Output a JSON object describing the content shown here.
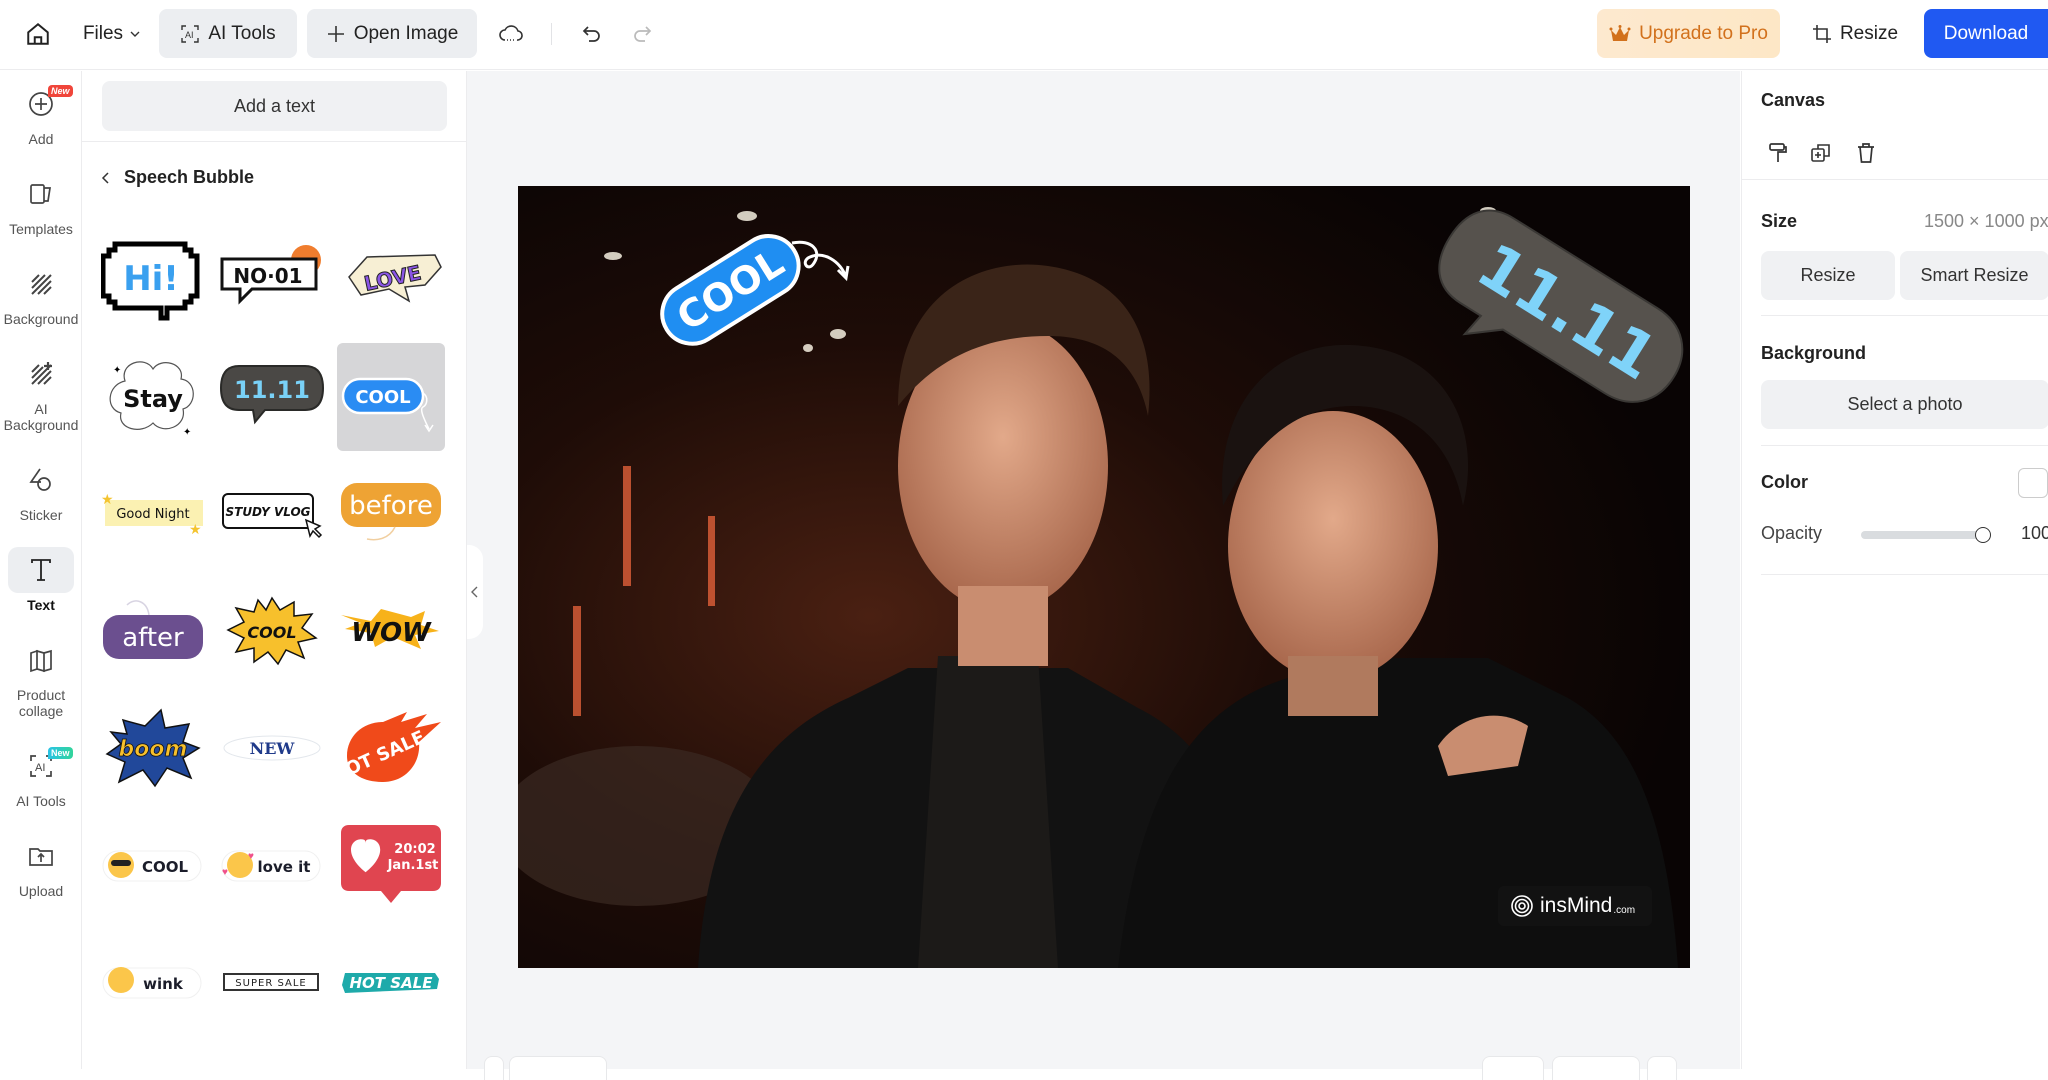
{
  "topbar": {
    "files_label": "Files",
    "ai_tools_label": "AI Tools",
    "open_image_label": "Open Image",
    "upgrade_label": "Upgrade to Pro",
    "resize_label": "Resize",
    "download_label": "Download",
    "colors": {
      "download_bg": "#2059f2",
      "upgrade_text": "#d2711c",
      "upgrade_bg": "#fde9cf"
    }
  },
  "rail": {
    "items": [
      {
        "label": "Add",
        "icon": "plus-circle-icon",
        "badge": "New"
      },
      {
        "label": "Templates",
        "icon": "templates-icon"
      },
      {
        "label": "Background",
        "icon": "background-hatch-icon"
      },
      {
        "label": "AI\nBackground",
        "icon": "ai-background-icon"
      },
      {
        "label": "Sticker",
        "icon": "sticker-icon"
      },
      {
        "label": "Text",
        "icon": "text-icon",
        "active": true
      },
      {
        "label": "Product\ncollage",
        "icon": "collage-icon"
      },
      {
        "label": "AI Tools",
        "icon": "ai-tools-icon",
        "badge": "New"
      },
      {
        "label": "Upload",
        "icon": "upload-icon"
      }
    ]
  },
  "panel": {
    "add_text_label": "Add a text",
    "section_title": "Speech Bubble",
    "stickers": [
      {
        "text": "Hi!",
        "style": "pixel-bubble"
      },
      {
        "text": "NO·01",
        "style": "boxed-bubble"
      },
      {
        "text": "LOVE",
        "style": "love-bubble"
      },
      {
        "text": "Stay",
        "style": "cloud-bubble"
      },
      {
        "text": "11.11",
        "style": "stone-bubble"
      },
      {
        "text": "COOL",
        "style": "blue-pill",
        "selected": true
      },
      {
        "text": "Good Night",
        "style": "yellow-note"
      },
      {
        "text": "STUDY VLOG",
        "style": "cursor-box"
      },
      {
        "text": "before",
        "style": "orange-chalk"
      },
      {
        "text": "after",
        "style": "purple-chalk"
      },
      {
        "text": "COOL",
        "style": "starburst"
      },
      {
        "text": "WOW",
        "style": "lightning"
      },
      {
        "text": "boom",
        "style": "blue-burst"
      },
      {
        "text": "NEW",
        "style": "oval"
      },
      {
        "text": "HOT SALE",
        "style": "fireball"
      },
      {
        "text": "COOL",
        "style": "emoji-pill-sunglasses"
      },
      {
        "text": "love it",
        "style": "emoji-pill-hearts"
      },
      {
        "text": "20:02\nJan.1st",
        "style": "like-notification"
      },
      {
        "text": "wink",
        "style": "emoji-pill-wink"
      },
      {
        "text": "SUPER SALE",
        "style": "outline-box"
      },
      {
        "text": "HOT SALE",
        "style": "teal-brush"
      }
    ]
  },
  "canvas": {
    "sticker_cool": "COOL",
    "sticker_1111": "11.11",
    "watermark": "insMind",
    "watermark_suffix": ".com"
  },
  "right_panel": {
    "canvas_title": "Canvas",
    "size_label": "Size",
    "size_value": "1500 × 1000 px",
    "resize_label": "Resize",
    "smart_resize_label": "Smart Resize",
    "background_label": "Background",
    "select_photo_label": "Select a photo",
    "color_label": "Color",
    "color_value": "#ffffff",
    "opacity_label": "Opacity",
    "opacity_value": "100"
  }
}
